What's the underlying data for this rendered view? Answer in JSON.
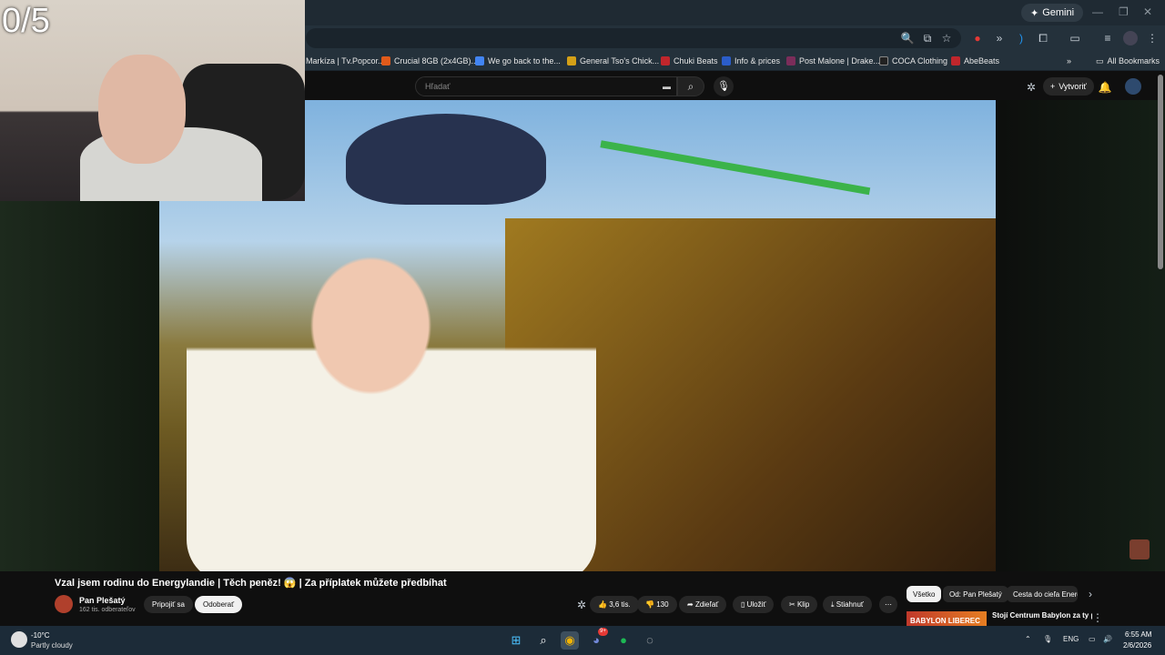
{
  "overlay": {
    "counter": "0/5"
  },
  "browser": {
    "gemini_label": "Gemini",
    "bookmarks": [
      {
        "label": "Markíza | Tv.Popcor...",
        "color": "#3c6fd1"
      },
      {
        "label": "Crucial 8GB (2x4GB)...",
        "color": "#e05a1a"
      },
      {
        "label": "We go back to the...",
        "color": "#4285f4"
      },
      {
        "label": "General Tso's Chick...",
        "color": "#d4a017"
      },
      {
        "label": "Chuki Beats",
        "color": "#c0262c"
      },
      {
        "label": "Info & prices",
        "color": "#2b5dc9"
      },
      {
        "label": "Post Malone | Drake...",
        "color": "#7b2d5a"
      },
      {
        "label": "COCA Clothing",
        "color": "#222222"
      },
      {
        "label": "AbeBeats",
        "color": "#c0262c"
      }
    ],
    "all_bookmarks_label": "All Bookmarks"
  },
  "youtube": {
    "search_placeholder": "Hľadať",
    "create_label": "Vytvoriť",
    "video_title": "Vzal jsem rodinu do Energylandie | Těch peněz! 😱 | Za příplatek můžete předbíhat",
    "channel_name": "Pan Plešatý",
    "channel_subs": "162 tis. odberateľov",
    "join_label": "Pripojiť sa",
    "subscribe_label": "Odoberať",
    "like_count": "3,6 tis.",
    "dislike_count": "130",
    "share_label": "Zdieľať",
    "save_label": "Uložiť",
    "clip_label": "Klip",
    "download_label": "Stiahnuť",
    "chips": [
      "Všetko",
      "Od: Pan Plešatý",
      "Cesta do cieľa Energ"
    ],
    "rec_thumb_text": "BABYLON LIBEREC",
    "rec_title": "Stojí Centrum Babylon za ty peníze? | OLANDIA | Aquapar"
  },
  "taskbar": {
    "temperature": "-10°C",
    "weather": "Partly cloudy",
    "language": "ENG",
    "time": "6:55 AM",
    "date": "2/6/2026",
    "discord_badge": "9+"
  }
}
